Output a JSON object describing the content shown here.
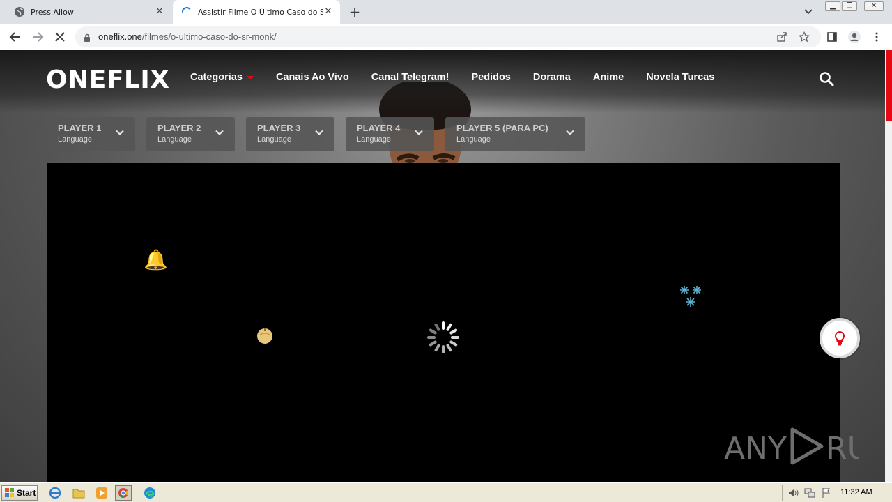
{
  "browser": {
    "tabs": [
      {
        "title": "Press Allow",
        "active": false
      },
      {
        "title": "Assistir Filme O Último Caso do Sr. Monk",
        "active": true
      }
    ],
    "new_tab_label": "+",
    "url": {
      "host": "oneflix.one",
      "path": "/filmes/o-ultimo-caso-do-sr-monk/"
    }
  },
  "site": {
    "logo": "ONEFLIX",
    "nav": [
      {
        "label": "Categorias",
        "has_dropdown": true
      },
      {
        "label": "Canais Ao Vivo"
      },
      {
        "label": "Canal Telegram!"
      },
      {
        "label": "Pedidos"
      },
      {
        "label": "Dorama"
      },
      {
        "label": "Anime"
      },
      {
        "label": "Novela Turcas"
      }
    ],
    "players": [
      {
        "name": "PLAYER 1",
        "lang": "Language"
      },
      {
        "name": "PLAYER 2",
        "lang": "Language"
      },
      {
        "name": "PLAYER 3",
        "lang": "Language"
      },
      {
        "name": "PLAYER 4",
        "lang": "Language"
      },
      {
        "name": "PLAYER 5 (PARA PC)",
        "lang": "Language"
      }
    ],
    "decorations": {
      "bells": "🔔",
      "ornament": "🎃",
      "snow": "❄"
    },
    "watermark": "ANY RUN"
  },
  "taskbar": {
    "start_label": "Start",
    "clock": "11:32 AM"
  },
  "colors": {
    "accent": "#e50914",
    "tab_strip": "#dee1e6",
    "taskbar": "#ece9d8"
  }
}
